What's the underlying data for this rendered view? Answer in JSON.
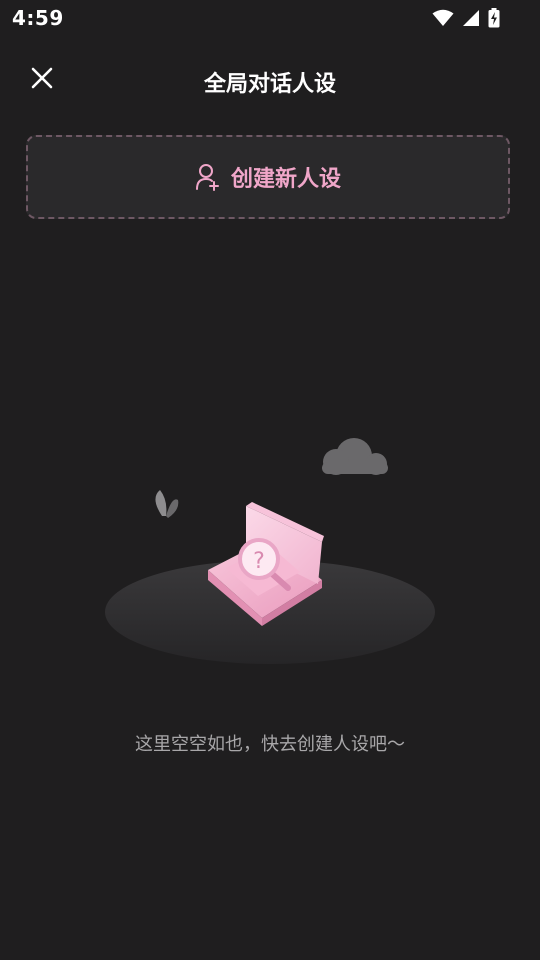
{
  "status_bar": {
    "time": "4:59",
    "icons": [
      "wifi-icon",
      "signal-icon",
      "battery-charging-icon"
    ]
  },
  "header": {
    "close_icon": "close-icon",
    "title": "全局对话人设"
  },
  "create_button": {
    "icon": "add-user-icon",
    "label": "创建新人设"
  },
  "empty_state": {
    "message": "这里空空如也，快去创建人设吧～"
  },
  "colors": {
    "background": "#1f1e1f",
    "accent_pink": "#f0a6c9",
    "dashed_border": "#6e5864",
    "card_bg": "#2a292b"
  }
}
